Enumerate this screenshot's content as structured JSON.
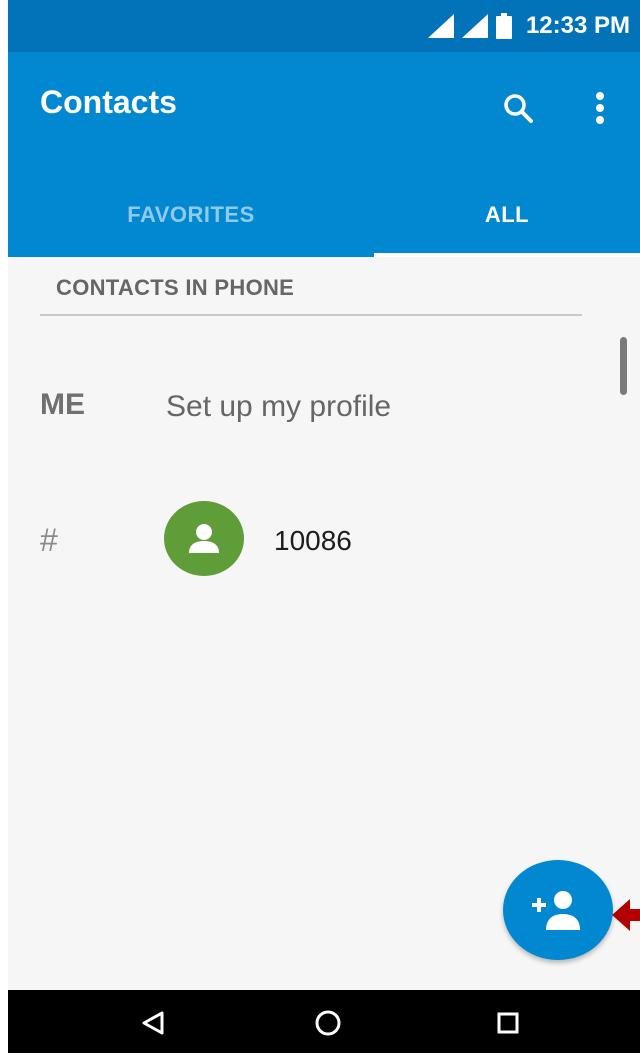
{
  "status_bar": {
    "time": "12:33 PM",
    "icons": [
      "signal-icon",
      "signal-icon",
      "battery-icon"
    ]
  },
  "app_bar": {
    "title": "Contacts",
    "actions": [
      "search-icon",
      "more-vert-icon"
    ]
  },
  "tabs": [
    {
      "label": "FAVORITES",
      "selected": false
    },
    {
      "label": "ALL",
      "selected": true
    }
  ],
  "list": {
    "section_header": "CONTACTS IN PHONE",
    "me": {
      "label": "ME",
      "text": "Set up my profile"
    },
    "contacts": [
      {
        "letter": "#",
        "name": "10086",
        "avatar_icon": "person-icon",
        "avatar_color": "#5f9d38"
      }
    ]
  },
  "fab": {
    "icon": "add-person-icon",
    "color": "#0288d1"
  },
  "nav_bar": {
    "buttons": [
      "back-icon",
      "home-icon",
      "recents-icon"
    ]
  },
  "colors": {
    "accent": "#0288d1",
    "status_bar": "#0273b8",
    "annotation_arrow": "#b30000"
  }
}
